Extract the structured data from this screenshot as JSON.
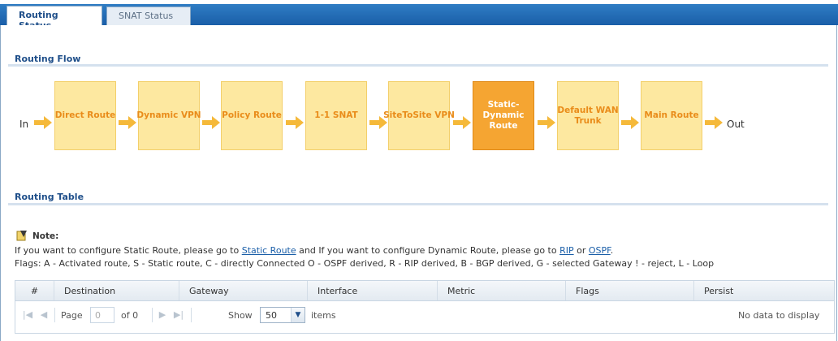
{
  "tabs": [
    {
      "label": "Routing Status",
      "active": true
    },
    {
      "label": "SNAT Status",
      "active": false
    }
  ],
  "routing_flow": {
    "title": "Routing Flow",
    "in_label": "In",
    "out_label": "Out",
    "steps": [
      {
        "label": "Direct Route",
        "active": false
      },
      {
        "label": "Dynamic VPN",
        "active": false
      },
      {
        "label": "Policy Route",
        "active": false
      },
      {
        "label": "1-1 SNAT",
        "active": false
      },
      {
        "label": "SiteToSite VPN",
        "active": false
      },
      {
        "label": "Static-Dynamic Route",
        "active": true
      },
      {
        "label": "Default WAN Trunk",
        "active": false
      },
      {
        "label": "Main Route",
        "active": false
      }
    ]
  },
  "routing_table": {
    "title": "Routing Table",
    "note": {
      "title": "Note:",
      "line1_prefix": "If you want to configure Static Route, please go to ",
      "static_route_link": "Static Route",
      "line1_middle": " and If you want to configure Dynamic Route, please go to ",
      "rip_link": "RIP",
      "line1_or": " or ",
      "ospf_link": "OSPF",
      "line1_suffix": ".",
      "flags_line": "Flags: A - Activated route, S - Static route, C - directly Connected O - OSPF derived, R - RIP derived, B - BGP derived, G - selected Gateway ! - reject, L - Loop"
    },
    "columns": [
      "#",
      "Destination",
      "Gateway",
      "Interface",
      "Metric",
      "Flags",
      "Persist"
    ],
    "pager": {
      "page_label": "Page",
      "page_value": "0",
      "of_label": "of 0",
      "show_label": "Show",
      "page_size": "50",
      "items_label": "items",
      "empty_message": "No data to display"
    }
  },
  "colors": {
    "accent": "#1f4f8a",
    "step_fill": "#fde8a0",
    "step_text": "#e98c1a",
    "step_active_fill": "#f5a532",
    "arrow": "#f5b93a"
  }
}
